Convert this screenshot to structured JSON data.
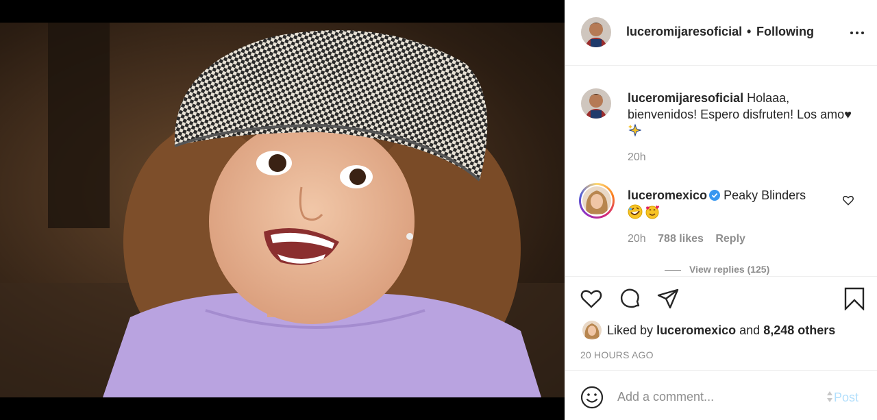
{
  "header": {
    "username": "luceromijaresoficial",
    "separator": "•",
    "follow_status": "Following"
  },
  "caption": {
    "username": "luceromijaresoficial",
    "text": "Holaaa, bienvenidos! Espero disfruten! Los amo",
    "time": "20h"
  },
  "comment": {
    "username": "luceromexico",
    "text": "Peaky Blinders",
    "time": "20h",
    "likes": "788 likes",
    "reply_label": "Reply",
    "view_replies": "View replies (125)"
  },
  "likes": {
    "prefix": "Liked by",
    "user": "luceromexico",
    "connector": "and",
    "others": "8,248 others"
  },
  "timestamp": "20 HOURS AGO",
  "add_comment": {
    "placeholder": "Add a comment...",
    "post_label": "Post"
  },
  "colors": {
    "verified": "#3897f0",
    "muted": "#8e8e8e",
    "post_disabled": "#b2dffc",
    "dress": "#b9a3e0"
  }
}
